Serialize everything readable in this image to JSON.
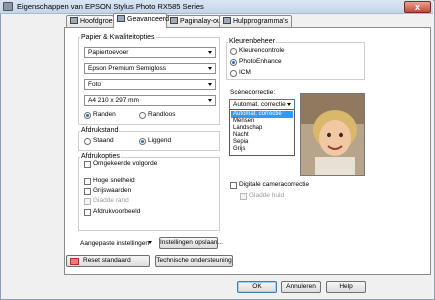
{
  "window": {
    "title": "Eigenschappen van EPSON Stylus Photo RX585 Series",
    "close_glyph": "x"
  },
  "tabs": [
    {
      "label": "Hoofdgroep"
    },
    {
      "label": "Geavanceerd"
    },
    {
      "label": "Paginalay-out"
    },
    {
      "label": "Hulpprogramma's"
    }
  ],
  "paper": {
    "group_label": "Papier & Kwaliteitopties",
    "source": "Papiertoevoer",
    "paper_type": "Epson Premium Semigloss",
    "quality": "Foto",
    "size": "A4 210 x 297 mm",
    "borders": {
      "bordered": "Randen",
      "borderless": "Randloos"
    }
  },
  "orientation": {
    "group_label": "Afdrukstand",
    "portrait": "Staand",
    "landscape": "Liggend"
  },
  "print_options": {
    "group_label": "Afdrukopties",
    "reverse_order": "Omgekeerde volgorde",
    "high_speed": "Hoge snelheid",
    "grayscale": "Grijswaarden",
    "smooth_edge": "Gladde rand",
    "print_preview": "Afdrukvoorbeeld"
  },
  "custom": {
    "label": "Aangepaste instellingen",
    "settings_button": "Instellingen opslaan..."
  },
  "bottom_buttons": {
    "reset": "Reset standaard",
    "support": "Technische ondersteuning",
    "ok": "OK",
    "cancel": "Annuleren",
    "help": "Help"
  },
  "color_management": {
    "group_label": "Kleurenbeheer",
    "color_controls": "Kleurencontrole",
    "photo_enhance": "PhotoEnhance",
    "icm": "ICM"
  },
  "scene": {
    "label": "Scènecorrectie:",
    "selected": "Automat. correctie",
    "options": [
      "Automat. correctie",
      "Mensen",
      "Landschap",
      "Nacht",
      "Sepia",
      "Grijs"
    ]
  },
  "digital_camera": {
    "label": "Digitale cameracorrectie",
    "smooth_skin": "Gladde huid"
  },
  "colors": {
    "accent": "#2a6fc9",
    "selection": "#3399ff"
  }
}
